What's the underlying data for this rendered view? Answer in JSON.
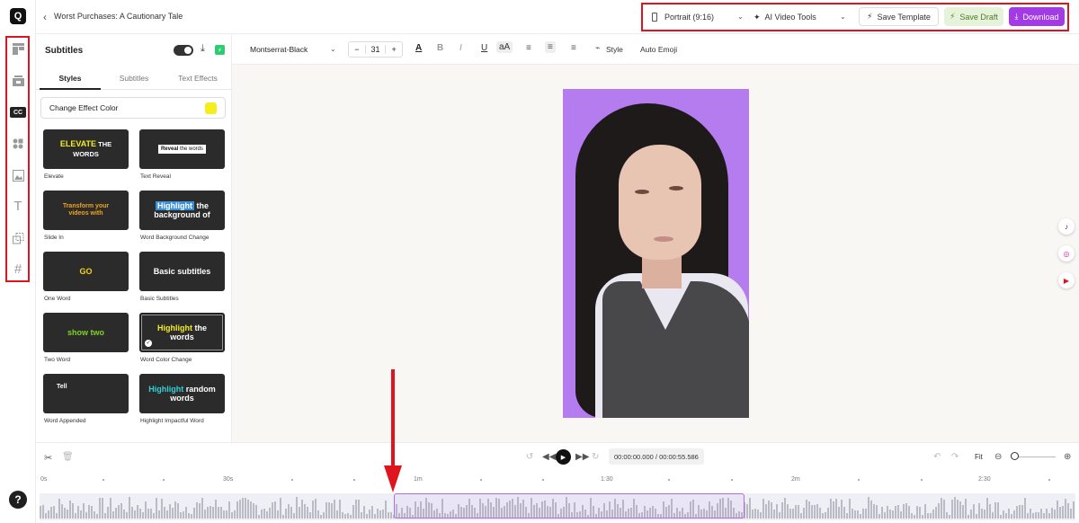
{
  "header": {
    "project_title": "Worst Purchases: A Cautionary Tale",
    "aspect_ratio": "Portrait (9:16)",
    "ai_tools": "AI Video Tools",
    "save_template": "Save Template",
    "save_draft": "Save Draft",
    "download": "Download"
  },
  "rail": {
    "items": [
      "layout-icon",
      "media-icon",
      "captions-icon",
      "elements-icon",
      "image-icon",
      "text-icon",
      "resize-icon",
      "hashtag-icon"
    ],
    "active_badge": "CC",
    "text_glyph": "T",
    "hashtag_glyph": "#",
    "help": "?"
  },
  "panel": {
    "title": "Subtitles",
    "tabs": [
      "Styles",
      "Subtitles",
      "Text Effects"
    ],
    "change_effect_color": "Change Effect Color",
    "effect_color": "#f5ee1c",
    "styles": [
      {
        "label": "Elevate",
        "preview_a": "ELEVATE",
        "preview_b": " THE",
        "preview_c": "WORDS"
      },
      {
        "label": "Text Reveal",
        "preview_a": "Reveal",
        "preview_b": " the words"
      },
      {
        "label": "Slide In",
        "preview_a": "Transform your",
        "preview_b": "videos with"
      },
      {
        "label": "Word Background Change",
        "preview_a": "Highlight",
        "preview_b": " the",
        "preview_c": "background of"
      },
      {
        "label": "One Word",
        "preview_a": "GO"
      },
      {
        "label": "Basic Subtitles",
        "preview_a": "Basic subtitles"
      },
      {
        "label": "Two Word",
        "preview_a": "show two"
      },
      {
        "label": "Word Color Change",
        "preview_a": "Highlight",
        "preview_b": " the",
        "preview_c": "words"
      },
      {
        "label": "Word Appended",
        "preview_a": "Tell"
      },
      {
        "label": "Highlight Impactful Word",
        "preview_a": "Highlight",
        "preview_b": " random",
        "preview_c": "words"
      }
    ]
  },
  "toolbar": {
    "font": "Montserrat-Black",
    "size": "31",
    "minus": "−",
    "plus": "+",
    "text_color": "A",
    "bold": "B",
    "italic": "I",
    "underline": "U",
    "case": "aA",
    "style": "Style",
    "auto_emoji": "Auto Emoji"
  },
  "social": {
    "tiktok": "♪",
    "instagram": "◎",
    "youtube": "▶"
  },
  "timeline": {
    "current_time": "00:00:00.000",
    "separator": " / ",
    "total_time": "00:00:55.586",
    "fit": "Fit",
    "ruler": [
      "0s",
      "30s",
      "1m",
      "1:30",
      "2m",
      "2:30"
    ]
  }
}
